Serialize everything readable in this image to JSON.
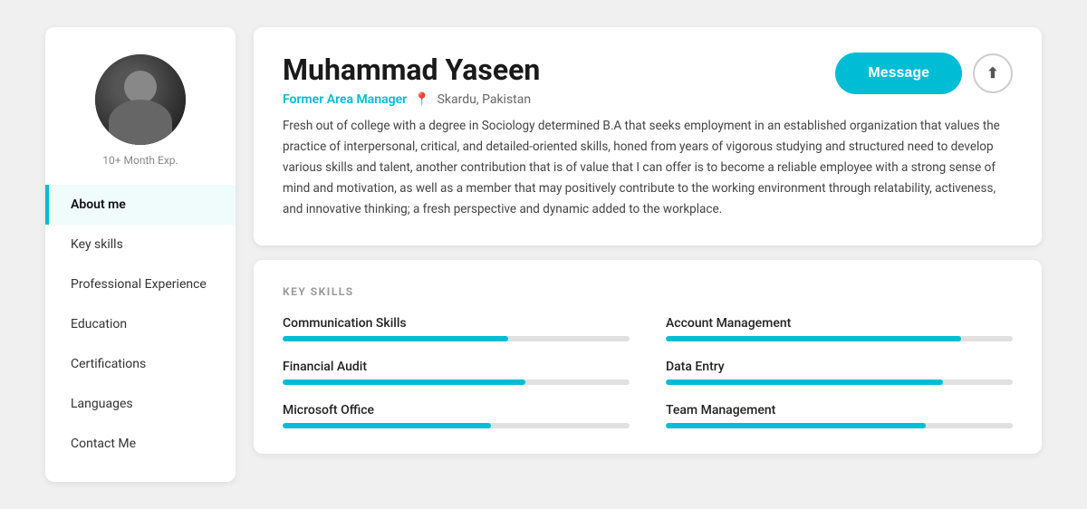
{
  "sidebar": {
    "avatar_alt": "Muhammad Yaseen photo",
    "exp_label": "10+ Month Exp.",
    "nav_items": [
      {
        "id": "about",
        "label": "About me",
        "active": true
      },
      {
        "id": "key-skills",
        "label": "Key skills",
        "active": false
      },
      {
        "id": "professional-experience",
        "label": "Professional Experience",
        "active": false
      },
      {
        "id": "education",
        "label": "Education",
        "active": false
      },
      {
        "id": "certifications",
        "label": "Certifications",
        "active": false
      },
      {
        "id": "languages",
        "label": "Languages",
        "active": false
      },
      {
        "id": "contact-me",
        "label": "Contact Me",
        "active": false
      }
    ]
  },
  "profile": {
    "name": "Muhammad Yaseen",
    "role": "Former Area Manager",
    "location": "Skardu, Pakistan",
    "bio": "Fresh out of college with a degree in Sociology determined B.A that seeks employment in an established organization that values the practice of interpersonal, critical, and detailed-oriented skills, honed from years of vigorous studying and structured need to develop various skills and talent, another contribution that is of value that I can offer is to become a reliable employee with a strong sense of mind and motivation, as well as a member that may positively contribute to the working environment through relatability, activeness, and innovative thinking; a fresh perspective and dynamic added to the workplace.",
    "message_btn": "Message",
    "share_btn_icon": "↑"
  },
  "skills": {
    "section_title": "KEY SKILLS",
    "items": [
      {
        "name": "Communication Skills",
        "percent": 65
      },
      {
        "name": "Account Management",
        "percent": 85
      },
      {
        "name": "Financial Audit",
        "percent": 70
      },
      {
        "name": "Data Entry",
        "percent": 80
      },
      {
        "name": "Microsoft Office",
        "percent": 60
      },
      {
        "name": "Team Management",
        "percent": 75
      }
    ]
  }
}
